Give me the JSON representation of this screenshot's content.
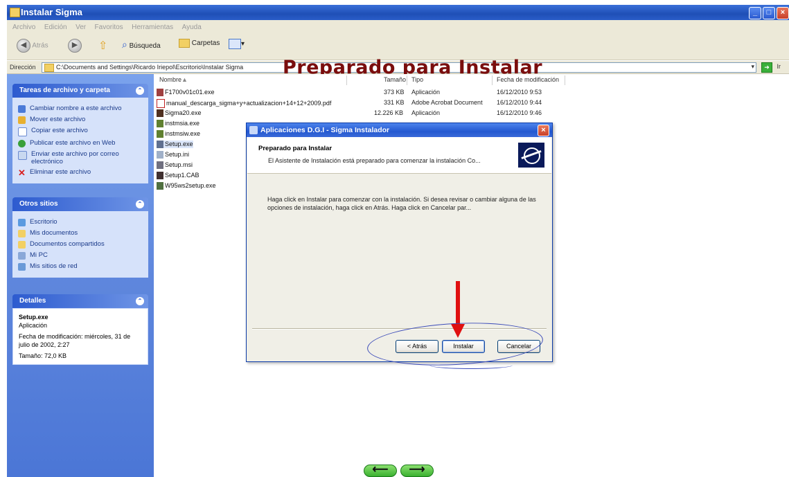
{
  "window": {
    "title": "Instalar Sigma",
    "menu": [
      "Archivo",
      "Edición",
      "Ver",
      "Favoritos",
      "Herramientas",
      "Ayuda"
    ]
  },
  "toolbar": {
    "back": "Atrás",
    "search": "Búsqueda",
    "folders": "Carpetas"
  },
  "address": {
    "label": "Dirección",
    "path": "C:\\Documents and Settings\\Ricardo Iriepol\\Escritorio\\Instalar Sigma",
    "go": "Ir"
  },
  "overlay_title": "Preparado para Instalar",
  "sidebar": {
    "tasks": {
      "header": "Tareas de archivo y carpeta",
      "items": [
        "Cambiar nombre a este archivo",
        "Mover este archivo",
        "Copiar este archivo",
        "Publicar este archivo en Web",
        "Enviar este archivo por correo electrónico",
        "Eliminar este archivo"
      ]
    },
    "places": {
      "header": "Otros sitios",
      "items": [
        "Escritorio",
        "Mis documentos",
        "Documentos compartidos",
        "Mi PC",
        "Mis sitios de red"
      ]
    },
    "details": {
      "header": "Detalles",
      "name": "Setup.exe",
      "type": "Aplicación",
      "modified": "Fecha de modificación: miércoles, 31 de julio de 2002, 2:27",
      "size": "Tamaño: 72,0 KB"
    }
  },
  "files": {
    "columns": {
      "name": "Nombre",
      "size": "Tamaño",
      "type": "Tipo",
      "date": "Fecha de modificación"
    },
    "rows": [
      {
        "name": "F1700v01c01.exe",
        "size": "373 KB",
        "type": "Aplicación",
        "date": "16/12/2010 9:53"
      },
      {
        "name": "manual_descarga_sigma+y+actualizacion+14+12+2009.pdf",
        "size": "331 KB",
        "type": "Adobe Acrobat Document",
        "date": "16/12/2010 9:44"
      },
      {
        "name": "Sigma20.exe",
        "size": "12.226 KB",
        "type": "Aplicación",
        "date": "16/12/2010 9:46"
      },
      {
        "name": "instmsia.exe",
        "size": "",
        "type": "",
        "date": ""
      },
      {
        "name": "instmsiw.exe",
        "size": "",
        "type": "",
        "date": ""
      },
      {
        "name": "Setup.exe",
        "size": "",
        "type": "",
        "date": ""
      },
      {
        "name": "Setup.ini",
        "size": "",
        "type": "",
        "date": ""
      },
      {
        "name": "Setup.msi",
        "size": "",
        "type": "",
        "date": ""
      },
      {
        "name": "Setup1.CAB",
        "size": "",
        "type": "",
        "date": ""
      },
      {
        "name": "W95ws2setup.exe",
        "size": "",
        "type": "",
        "date": ""
      }
    ]
  },
  "dialog": {
    "title": "Aplicaciones D.G.I - Sigma Instalador",
    "heading": "Preparado para Instalar",
    "subheading": "El Asistente de Instalación está preparado para comenzar la instalación Co...",
    "body": "Haga click en Instalar para comenzar con la instalación.  Si desea revisar o cambiar alguna de las opciones de instalación, haga click en Atrás.  Haga click en Cancelar par...",
    "buttons": {
      "back": "< Atrás",
      "install": "Instalar",
      "cancel": "Cancelar"
    }
  },
  "nav": {
    "prev": "⟵",
    "next": "⟶"
  }
}
